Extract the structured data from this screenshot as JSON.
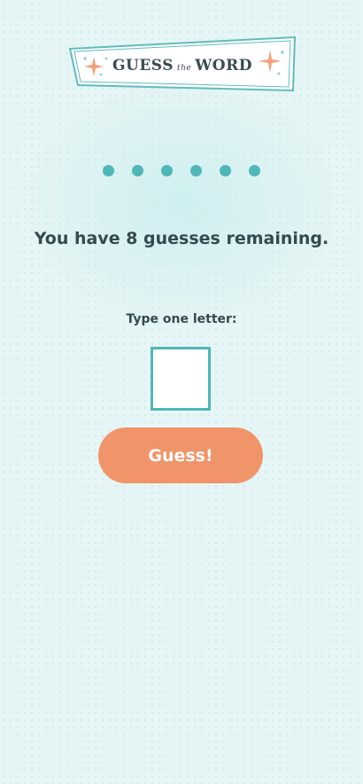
{
  "logo": {
    "word1": "GUESS",
    "word2": "the",
    "word3": "WORD"
  },
  "game": {
    "hidden_letter_count": 6,
    "status_text": "You have 8 guesses remaining.",
    "prompt_label": "Type one letter:",
    "letter_value": "",
    "guess_button_label": "Guess!"
  },
  "colors": {
    "accent_teal": "#4fb7b8",
    "button_orange": "#f09469",
    "text_dark": "#344a50",
    "background": "#e6f5f5"
  }
}
